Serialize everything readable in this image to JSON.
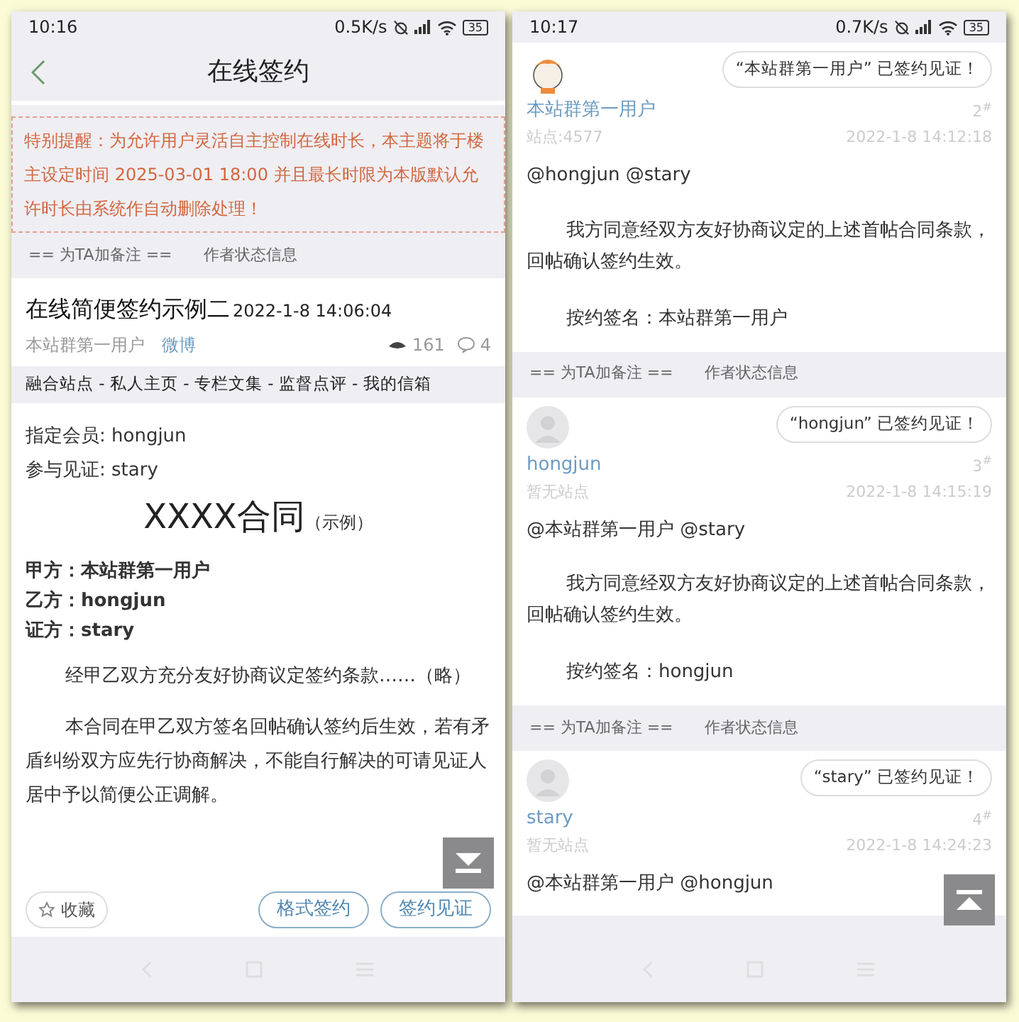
{
  "left_screen": {
    "status_bar": {
      "time": "10:16",
      "speed": "0.5K/s",
      "battery": "35"
    },
    "header": {
      "title": "在线签约"
    },
    "notice": "特别提醒：为允许用户灵活自主控制在线时长，本主题将于楼主设定时间 2025-03-01 18:00 并且最长时限为本版默认允许时长由系统作自动删除处理！",
    "author_bar": {
      "note": "== 为TA加备注 ==",
      "info": "作者状态信息"
    },
    "post": {
      "title": "在线简便签约示例二",
      "date": "2022-1-8 14:06:04",
      "author": "本站群第一用户",
      "link": "微博",
      "views": "161",
      "comments": "4",
      "nav": "融合站点 - 私人主页 - 专栏文集 - 监督点评 - 我的信箱",
      "member": "指定会员: hongjun",
      "witness": "参与见证: stary",
      "contract_title": "XXXX合同",
      "contract_note": "（示例）",
      "parties": [
        "甲方：本站群第一用户",
        "乙方：hongjun",
        "证方：stary"
      ],
      "paragraphs": [
        "经甲乙双方充分友好协商议定签约条款……（略）",
        "本合同在甲乙双方签名回帖确认签约后生效，若有矛盾纠纷双方应先行协商解决，不能自行解决的可请见证人居中予以简便公正调解。"
      ],
      "favorite": "收藏",
      "buttons": [
        "格式签约",
        "签约见证"
      ]
    }
  },
  "right_screen": {
    "status_bar": {
      "time": "10:17",
      "speed": "0.7K/s",
      "battery": "35"
    },
    "replies": [
      {
        "kind": "cartoon",
        "badge": "“本站群第一用户” 已签约见证！",
        "name": "本站群第一用户",
        "site": "站点:4577",
        "floor": "2$^{#}$",
        "date": "2022-1-8 14:12:18",
        "mention": "@hongjun @stary",
        "paragraphs": [
          "我方同意经双方友好协商议定的上述首帖合同条款，回帖确认签约生效。",
          "按约签名：本站群第一用户"
        ]
      },
      {
        "kind": "default",
        "author_bar": {
          "note": "== 为TA加备注 ==",
          "info": "作者状态信息"
        },
        "badge": "“hongjun” 已签约见证！",
        "name": "hongjun",
        "site": "暂无站点",
        "floor": "3$^{#}$",
        "date": "2022-1-8 14:15:19",
        "mention": "@本站群第一用户 @stary",
        "paragraphs": [
          "我方同意经双方友好协商议定的上述首帖合同条款，回帖确认签约生效。",
          "按约签名：hongjun"
        ]
      },
      {
        "kind": "default",
        "author_bar": {
          "note": "== 为TA加备注 ==",
          "info": "作者状态信息"
        },
        "badge": "“stary” 已签约见证！",
        "name": "stary",
        "site": "暂无站点",
        "floor": "4$^{#}$",
        "date": "2022-1-8 14:24:23",
        "mention": "@本站群第一用户 @hongjun"
      }
    ]
  }
}
